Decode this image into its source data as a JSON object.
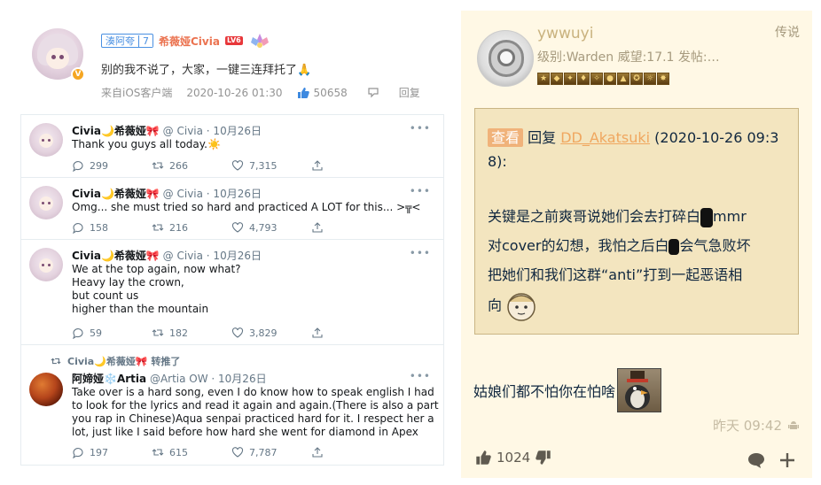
{
  "weibo": {
    "fan_badge_name": "湊阿夸",
    "fan_badge_level": "7",
    "username": "希薇娅Civia",
    "level_badge": "LV6",
    "verified_mark": "V",
    "post_text": "别的我不说了，大家，一键三连拜托了🙏",
    "source": "来自iOS客户端",
    "timestamp": "2020-10-26 01:30",
    "like_count": "50658",
    "reply_label": "回复"
  },
  "tweets": [
    {
      "display_name": "Civia🌙希薇娅🎀",
      "handle": "@ Civia · 10月26日",
      "text": [
        "Thank you guys all today.☀️"
      ],
      "replies": "299",
      "retweets": "266",
      "likes": "7,315"
    },
    {
      "display_name": "Civia🌙希薇娅🎀",
      "handle": "@ Civia · 10月26日",
      "text": [
        "Omg... she must tried so hard and practiced A LOT for this... >╦<"
      ],
      "replies": "158",
      "retweets": "216",
      "likes": "4,793"
    },
    {
      "display_name": "Civia🌙希薇娅🎀",
      "handle": "@ Civia · 10月26日",
      "text": [
        "We at the top again, now what?",
        "Heavy lay the crown,",
        "but count us",
        "higher than the mountain"
      ],
      "replies": "59",
      "retweets": "182",
      "likes": "3,829"
    },
    {
      "retweet_note": "Civia🌙希薇娅🎀 转推了",
      "display_name": "阿媂娅❄️Artia",
      "handle": "@Artia OW · 10月26日",
      "text": [
        "Take over is a hard song, even I do know how to speak english I had",
        "to look for the lyrics and read it again and again.(There is also a part",
        "you rap in Chinese)Aqua senpai practiced hard for it. I respect her a",
        "lot, just like I said before how hard she went for diamond in Apex"
      ],
      "replies": "197",
      "retweets": "615",
      "likes": "7,787"
    }
  ],
  "nga": {
    "username": "ywwuyi",
    "tag": "传说",
    "info": "级别:Warden  威望:17.1  发帖:…",
    "badge_count": 10,
    "quote_view": "查看",
    "quote_reply": "回复",
    "quote_user": "DD_Akatsuki",
    "quote_time": "(2020-10-26 09:3",
    "quote_time_cont": "8):",
    "quote_body": {
      "p1": "关键是之前爽哥说她们会去打碎白",
      "p2": "mmr",
      "p3": "对cover的幻想，我怕之后白",
      "p4": "会气急败坏",
      "p5": "把她们和我们这群“anti”打到一起恶语相",
      "p6": "向"
    },
    "post_text": "姑娘们都不怕你在怕啥",
    "time": "昨天 09:42",
    "like_count": "1024"
  }
}
